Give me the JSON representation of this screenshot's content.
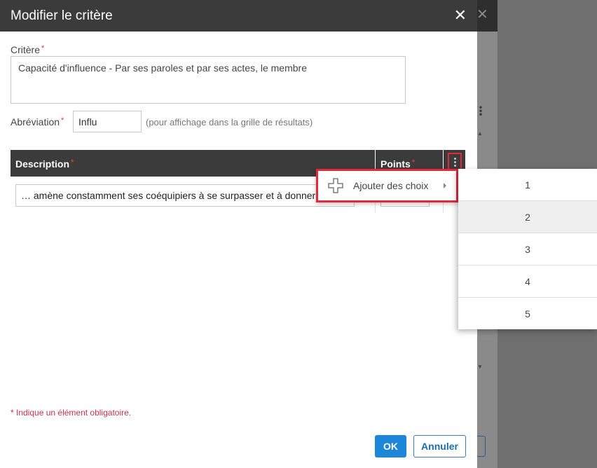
{
  "background": {
    "close_glyph": "✕",
    "menu_dots": "⋮"
  },
  "modal": {
    "title": "Modifier le critère",
    "close_glyph": "✕",
    "critere": {
      "label": "Critère",
      "value": "Capacité d'influence  -  Par ses paroles et par ses actes, le membre"
    },
    "abreviation": {
      "label": "Abréviation",
      "value": "Influ",
      "hint": "(pour affichage dans la grille de résultats)"
    },
    "required_mark": "*",
    "table": {
      "columns": [
        "Description",
        "Points"
      ],
      "rows": [
        {
          "description": "… amène constamment ses coéquipiers à se surpasser et à donner",
          "points": ""
        }
      ]
    },
    "required_note": "* Indique un élément obligatoire.",
    "buttons": {
      "ok": "OK",
      "cancel": "Annuler"
    }
  },
  "context_menu": {
    "items": [
      {
        "icon": "plus-icon",
        "label": "Ajouter des choix",
        "has_submenu": true
      }
    ]
  },
  "submenu": {
    "items": [
      "1",
      "2",
      "3",
      "4",
      "5"
    ],
    "highlighted_index": 1
  },
  "colors": {
    "header_bg": "#3b3b3b",
    "primary": "#1d86d8",
    "required": "#d0394f",
    "highlight_border": "#e02b3c"
  }
}
